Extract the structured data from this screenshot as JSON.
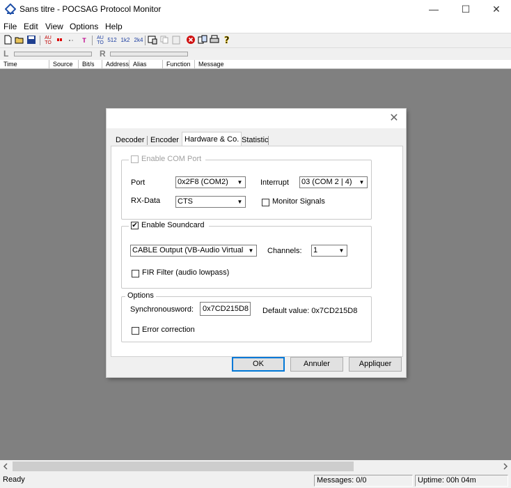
{
  "window": {
    "title": "Sans titre - POCSAG Protocol Monitor",
    "minimize_glyph": "—",
    "maximize_glyph": "☐",
    "close_glyph": "✕"
  },
  "menu": [
    "File",
    "Edit",
    "View",
    "Options",
    "Help"
  ],
  "toolbar": {
    "auto_label": "AU TO",
    "baud_auto": "AU TO",
    "b512": "512",
    "b1200": "1k2",
    "b2400": "2k4",
    "t_label": "T"
  },
  "levels": {
    "left_letter": "L",
    "right_letter": "R"
  },
  "columns": [
    "Time",
    "Source",
    "Bit/s",
    "Address",
    "Alias",
    "Function",
    "Message"
  ],
  "status": {
    "ready": "Ready",
    "messages": "Messages: 0/0",
    "uptime": "Uptime: 00h 04m"
  },
  "dialog": {
    "close_glyph": "✕",
    "tabs": [
      "Decoder",
      "Encoder",
      "Hardware & Co.",
      "Statistic"
    ],
    "active_tab": "Hardware & Co.",
    "com_group": {
      "enable_label": "Enable COM Port",
      "enabled": false,
      "port_label": "Port",
      "port_value": "0x2F8 (COM2)",
      "interrupt_label": "Interrupt",
      "interrupt_value": "03 (COM 2 | 4)",
      "rxdata_label": "RX-Data",
      "rxdata_value": "CTS",
      "monitor_label": "Monitor Signals"
    },
    "sound_group": {
      "enable_label": "Enable Soundcard",
      "enabled": true,
      "device_value": "CABLE Output (VB-Audio Virtual",
      "channels_label": "Channels:",
      "channels_value": "1",
      "fir_label": "FIR Filter (audio lowpass)"
    },
    "options_group": {
      "title": "Options",
      "sync_label": "Synchronousword:",
      "sync_value": "0x7CD215D8",
      "default_label": "Default value: 0x7CD215D8",
      "error_label": "Error correction"
    },
    "buttons": {
      "ok": "OK",
      "cancel": "Annuler",
      "apply": "Appliquer"
    },
    "check_glyph": "✔"
  }
}
